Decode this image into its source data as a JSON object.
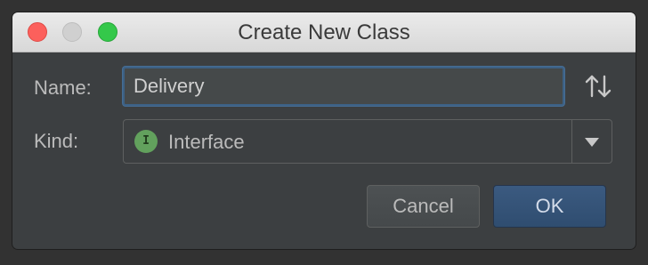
{
  "window": {
    "title": "Create New Class",
    "controls": [
      "close",
      "minimize",
      "maximize"
    ]
  },
  "form": {
    "name_label": "Name:",
    "name_value": "Delivery",
    "name_sort_icon": "sort-arrows-icon",
    "kind_label": "Kind:",
    "kind_value": "Interface",
    "kind_badge_letter": "I",
    "kind_badge_color": "#62a15d",
    "kind_dropdown_icon": "triangle-down-icon"
  },
  "buttons": {
    "cancel_label": "Cancel",
    "ok_label": "OK"
  },
  "colors": {
    "dialog_background": "#3c3f41",
    "focus_border": "#466d94",
    "default_button": "#2f4d70"
  }
}
